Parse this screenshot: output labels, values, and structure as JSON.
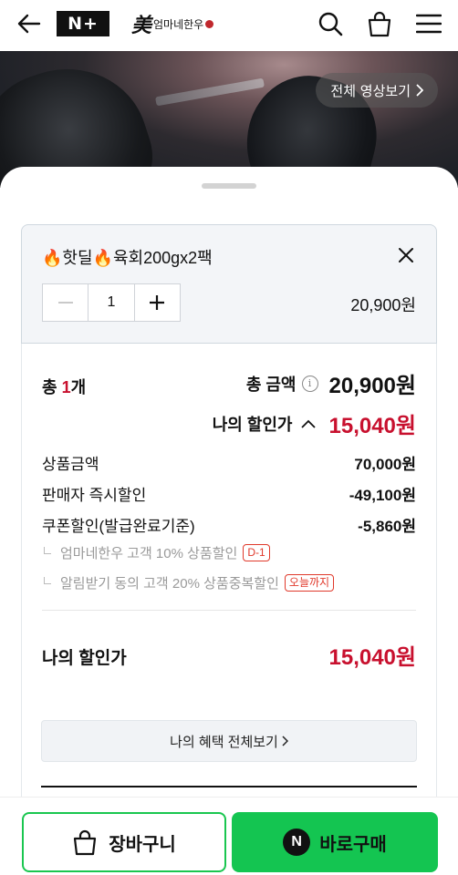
{
  "header": {
    "brand_plus": "N+",
    "store_mark": "美",
    "store_name": "엄마네한우",
    "icons": [
      "back-arrow-icon",
      "search-icon",
      "bag-icon",
      "menu-icon"
    ]
  },
  "banner": {
    "video_button_label": "전체 영상보기"
  },
  "option": {
    "title": "🔥핫딜🔥육회200gx2팩",
    "quantity": "1",
    "price": "20,900원"
  },
  "summary": {
    "count_prefix": "총 ",
    "count_value": "1",
    "count_suffix": "개",
    "total_label": "총 금액",
    "total_amount": "20,900원",
    "my_price_label": "나의 할인가",
    "my_price_amount": "15,040원",
    "lines": [
      {
        "label": "상품금액",
        "value": "70,000원"
      },
      {
        "label": "판매자 즉시할인",
        "value": "-49,100원"
      },
      {
        "label": "쿠폰할인(발급완료기준)",
        "value": "-5,860원"
      }
    ],
    "coupons": [
      {
        "label": "엄마네한우 고객 10% 상품할인",
        "badge": "D-1"
      },
      {
        "label": "알림받기 동의 고객 20% 상품중복할인",
        "badge": "오늘까지"
      }
    ],
    "final_label": "나의 할인가",
    "final_amount": "15,040원",
    "benefit_button": "나의 혜택 전체보기"
  },
  "bottom": {
    "cart_label": "장바구니",
    "buy_label": "바로구매",
    "pay_badge": "N"
  },
  "colors": {
    "accent_red": "#c8102e",
    "naver_green": "#14c551"
  }
}
